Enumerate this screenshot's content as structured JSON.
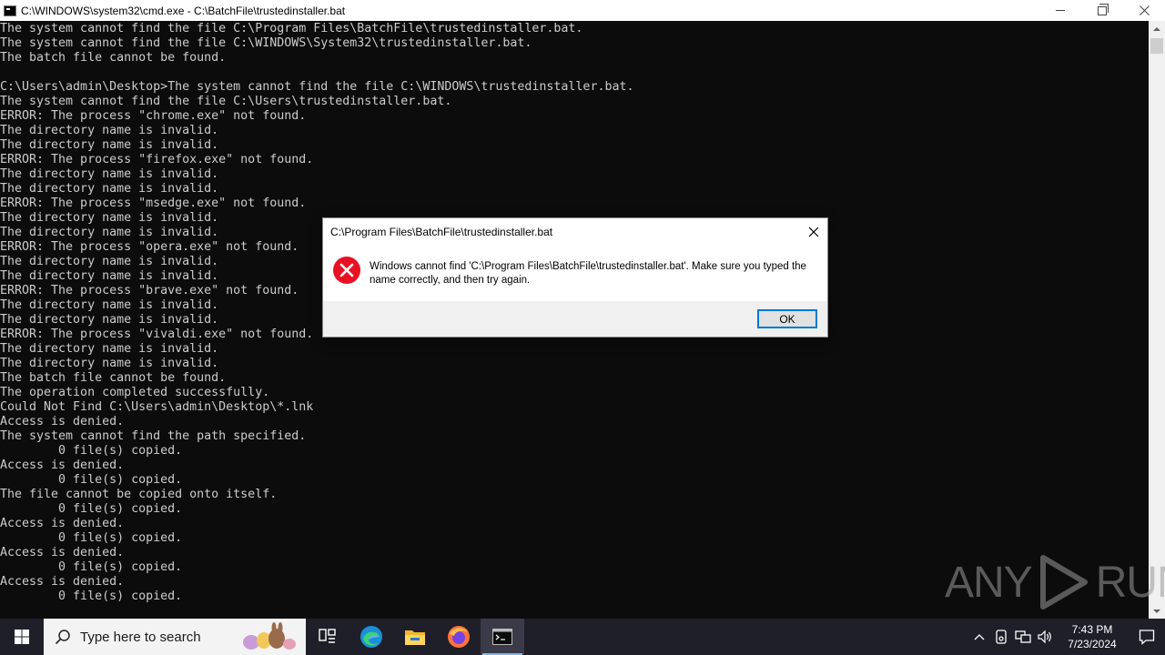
{
  "window": {
    "title": "C:\\WINDOWS\\system32\\cmd.exe - C:\\BatchFile\\trustedinstaller.bat"
  },
  "console": {
    "lines": [
      "The system cannot find the file C:\\Program Files\\BatchFile\\trustedinstaller.bat.",
      "The system cannot find the file C:\\WINDOWS\\System32\\trustedinstaller.bat.",
      "The batch file cannot be found.",
      "",
      "C:\\Users\\admin\\Desktop>The system cannot find the file C:\\WINDOWS\\trustedinstaller.bat.",
      "The system cannot find the file C:\\Users\\trustedinstaller.bat.",
      "ERROR: The process \"chrome.exe\" not found.",
      "The directory name is invalid.",
      "The directory name is invalid.",
      "ERROR: The process \"firefox.exe\" not found.",
      "The directory name is invalid.",
      "The directory name is invalid.",
      "ERROR: The process \"msedge.exe\" not found.",
      "The directory name is invalid.",
      "The directory name is invalid.",
      "ERROR: The process \"opera.exe\" not found.",
      "The directory name is invalid.",
      "The directory name is invalid.",
      "ERROR: The process \"brave.exe\" not found.",
      "The directory name is invalid.",
      "The directory name is invalid.",
      "ERROR: The process \"vivaldi.exe\" not found.",
      "The directory name is invalid.",
      "The directory name is invalid.",
      "The batch file cannot be found.",
      "The operation completed successfully.",
      "Could Not Find C:\\Users\\admin\\Desktop\\*.lnk",
      "Access is denied.",
      "The system cannot find the path specified.",
      "        0 file(s) copied.",
      "Access is denied.",
      "        0 file(s) copied.",
      "The file cannot be copied onto itself.",
      "        0 file(s) copied.",
      "Access is denied.",
      "        0 file(s) copied.",
      "Access is denied.",
      "        0 file(s) copied.",
      "Access is denied.",
      "        0 file(s) copied."
    ]
  },
  "watermark": {
    "left": "ANY",
    "right": "RUN"
  },
  "dialog": {
    "title": "C:\\Program Files\\BatchFile\\trustedinstaller.bat",
    "message": "Windows cannot find 'C:\\Program Files\\BatchFile\\trustedinstaller.bat'. Make sure you typed the name correctly, and then try again.",
    "ok_label": "OK",
    "icon": "error-icon"
  },
  "taskbar": {
    "search_placeholder": "Type here to search",
    "apps": [
      {
        "name": "task-view-icon"
      },
      {
        "name": "edge-icon"
      },
      {
        "name": "file-explorer-icon"
      },
      {
        "name": "firefox-icon"
      },
      {
        "name": "cmd-icon",
        "active": true
      }
    ],
    "clock": {
      "time": "7:43 PM",
      "date": "7/23/2024"
    }
  },
  "colors": {
    "console_bg": "#0c0c0c",
    "console_text": "#cccccc",
    "taskbar_bg": "#1f1f2a",
    "accent": "#0078d7",
    "error_red": "#e81123"
  }
}
